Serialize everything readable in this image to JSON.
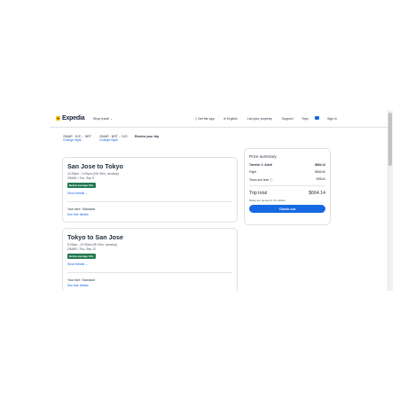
{
  "header": {
    "brand": "Expedia",
    "shop_travel": "Shop travel",
    "get_app": "Get the app",
    "language": "English",
    "list_property": "List your property",
    "support": "Support",
    "trips": "Trips",
    "sign_in": "Sign in"
  },
  "breadcrumbs": [
    {
      "route": "2/MAR · SJC→ NRT",
      "sub": "Change flight"
    },
    {
      "route": "2/MAR · NRT→ SJC",
      "sub": "Change flight"
    },
    {
      "route": "Review your trip",
      "sub": ""
    }
  ],
  "flights": [
    {
      "title": "San Jose to Tokyo",
      "time": "12:00pm - 2:00pm (10h 30m, nonstop)",
      "meta": "2/MAR • Thu, Sep 5",
      "badge": "Below average CO₂",
      "details": "Show details",
      "fare": "Your fare: Standard",
      "fare_link": "See fare details"
    },
    {
      "title": "Tokyo to San Jose",
      "time": "6:20pm - 12:00am (9h 30m, nonstop)",
      "meta": "2/MAR • Thu, Sep 12",
      "badge": "Below average CO₂",
      "details": "Show details",
      "fare": "Your fare: Standard",
      "fare_link": "See fare details"
    }
  ],
  "price_summary": {
    "title": "Price summary",
    "traveler": "Traveler 1: Adult",
    "traveler_amount": "$664.14",
    "flight": "Flight",
    "flight_amount": "$565.50",
    "taxes": "Taxes and fees",
    "taxes_amount": "$98.64",
    "total_label": "Trip total",
    "total_amount": "$664.14",
    "note": "Rates are quoted in US dollars",
    "checkout": "Check out"
  },
  "colors": {
    "accent": "#1668e3",
    "badge": "#227950",
    "brand_yellow": "#fcc40a"
  }
}
